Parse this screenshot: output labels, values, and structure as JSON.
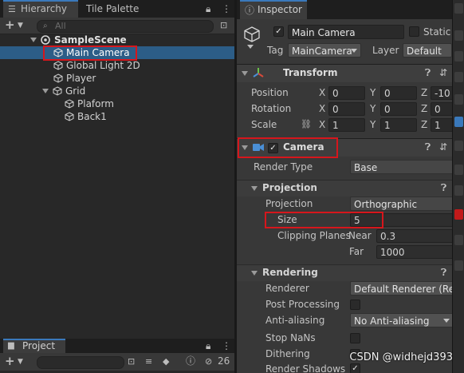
{
  "hierarchy": {
    "tab_label": "Hierarchy",
    "tab2_label": "Tile Palette",
    "search_placeholder": "All",
    "items": [
      {
        "label": "SampleScene"
      },
      {
        "label": "Main Camera"
      },
      {
        "label": "Global Light 2D"
      },
      {
        "label": "Player"
      },
      {
        "label": "Grid"
      },
      {
        "label": "Plaform"
      },
      {
        "label": "Back1"
      }
    ]
  },
  "project": {
    "tab_label": "Project",
    "hidden_count": "26"
  },
  "inspector": {
    "tab_label": "Inspector",
    "object_name": "Main Camera",
    "static_label": "Static",
    "tag_label": "Tag",
    "tag_value": "MainCamera",
    "layer_label": "Layer",
    "layer_value": "Default",
    "transform": {
      "title": "Transform",
      "rows": [
        {
          "label": "Position",
          "x": "0",
          "y": "0",
          "z": "-10"
        },
        {
          "label": "Rotation",
          "x": "0",
          "y": "0",
          "z": "0"
        },
        {
          "label": "Scale",
          "x": "1",
          "y": "1",
          "z": "1"
        }
      ],
      "axis_x": "X",
      "axis_y": "Y",
      "axis_z": "Z"
    },
    "camera": {
      "title": "Camera",
      "render_type_label": "Render Type",
      "render_type_value": "Base",
      "projection_section": "Projection",
      "projection_label": "Projection",
      "projection_value": "Orthographic",
      "size_label": "Size",
      "size_value": "5",
      "clipping_label": "Clipping Planes",
      "near_label": "Near",
      "near_value": "0.3",
      "far_label": "Far",
      "far_value": "1000",
      "rendering_section": "Rendering",
      "renderer_label": "Renderer",
      "renderer_value": "Default Renderer (Ren",
      "post_processing_label": "Post Processing",
      "anti_aliasing_label": "Anti-aliasing",
      "anti_aliasing_value": "No Anti-aliasing",
      "stop_nans_label": "Stop NaNs",
      "dithering_label": "Dithering",
      "render_shadows_label": "Render Shadows"
    }
  },
  "watermark": "CSDN @widhejd393",
  "colors": {
    "selection": "#2c5d87",
    "highlight_box": "#d6161c",
    "accent_tab": "#3a79bb"
  }
}
